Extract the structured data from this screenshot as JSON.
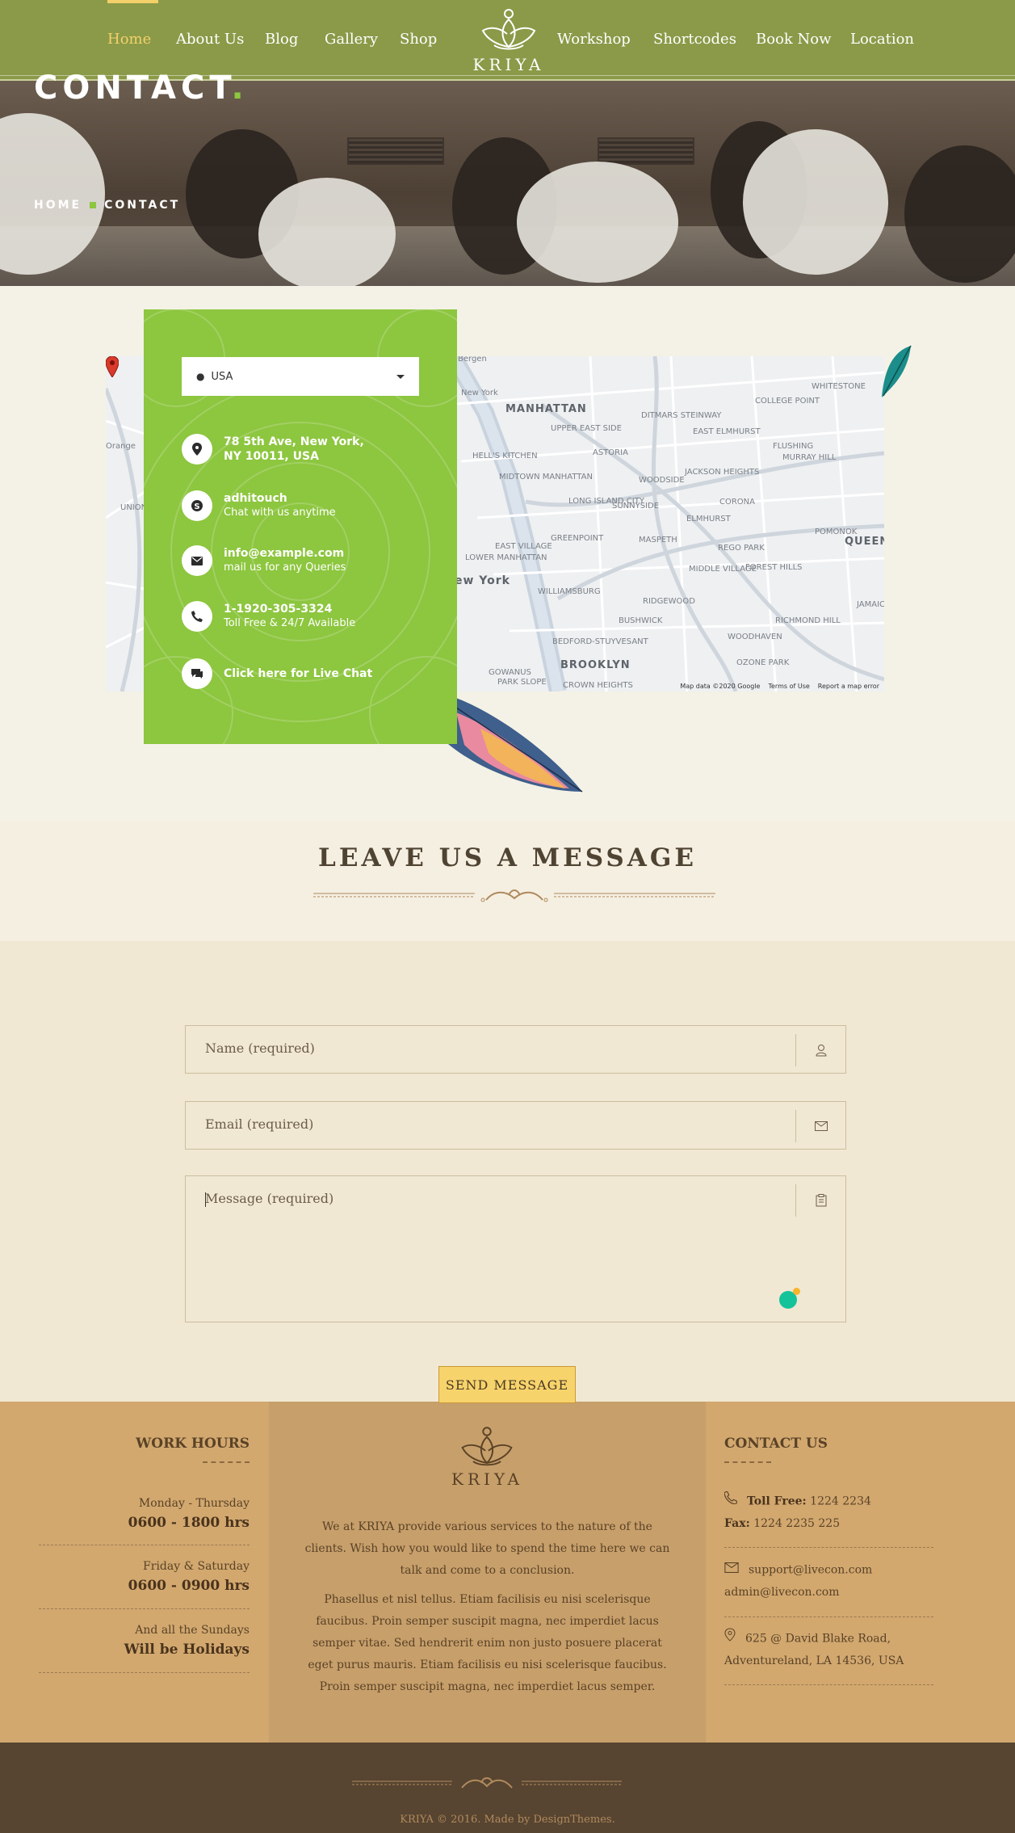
{
  "nav": {
    "items": [
      {
        "label": "Home",
        "active": true
      },
      {
        "label": "About Us"
      },
      {
        "label": "Blog"
      },
      {
        "label": "Gallery"
      },
      {
        "label": "Shop"
      },
      {
        "label": "Workshop"
      },
      {
        "label": "Shortcodes"
      },
      {
        "label": "Book Now"
      },
      {
        "label": "Location"
      }
    ],
    "logo_text": "KRIYA",
    "active_color": "#f3d06a"
  },
  "hero": {
    "title": "CONTACT",
    "title_dot": ".",
    "breadcrumb": [
      "HOME",
      "CONTACT"
    ]
  },
  "contact_card": {
    "country": "USA",
    "rows": [
      {
        "icon": "location-pin-icon",
        "title": "78 5th Ave, New York,",
        "sub": "NY 10011, USA",
        "sub_bold": true
      },
      {
        "icon": "skype-icon",
        "title": "adhitouch",
        "sub": "Chat with us anytime"
      },
      {
        "icon": "mail-icon",
        "title": "info@example.com",
        "sub": "mail us for any Queries"
      },
      {
        "icon": "phone-icon",
        "title": "1-1920-305-3324",
        "sub": "Toll Free & 24/7 Available"
      },
      {
        "icon": "chat-icon",
        "title": "Click here for Live Chat",
        "sub": ""
      }
    ],
    "card_color": "#8dc63f"
  },
  "map": {
    "labels": [
      "MANHATTAN",
      "QUEENS",
      "BROOKLYN",
      "ew York",
      "Bergen",
      "ASTORIA",
      "UPPER EAST SIDE",
      "HELL'S KITCHEN",
      "MIDTOWN MANHATTAN",
      "EAST VILLAGE",
      "LONG ISLAND CITY",
      "SUNNYSIDE",
      "WOODSIDE",
      "JACKSON HEIGHTS",
      "CORONA",
      "ELMHURST",
      "MASPETH",
      "GREENPOINT",
      "WILLIAMSBURG",
      "BUSHWICK",
      "RIDGEWOOD",
      "MIDDLE VILLAGE",
      "FOREST HILLS",
      "REGO PARK",
      "FLUSHING",
      "MURRAY HILL",
      "COLLEGE POINT",
      "WHITESTONE",
      "EAST ELMHURST",
      "DITMARS STEINWAY",
      "BEDFORD-STUYVESANT",
      "WOODHAVEN",
      "RICHMOND HILL",
      "OZONE PARK",
      "GOWANUS",
      "PARK SLOPE",
      "CROWN HEIGHTS",
      "POMONOK",
      "JAMAICA",
      "Orange",
      "UNION HEIGHTS",
      "LOWER MANHATTAN",
      "New York"
    ],
    "footer": [
      "Map data ©2020 Google",
      "Terms of Use",
      "Report a map error"
    ]
  },
  "message": {
    "title": "LEAVE US A MESSAGE",
    "name_placeholder": "Name (required)",
    "email_placeholder": "Email (required)",
    "message_placeholder": "Message (required)",
    "send_label": "SEND MESSAGE"
  },
  "footer": {
    "work_hours": {
      "heading": "WORK HOURS",
      "rows": [
        {
          "day": "Monday - Thursday",
          "time": "0600 - 1800 hrs"
        },
        {
          "day": "Friday & Saturday",
          "time": "0600 - 0900 hrs"
        },
        {
          "day": "And all the Sundays",
          "time": "Will be Holidays"
        }
      ]
    },
    "about": {
      "logo_text": "KRIYA",
      "para1": "We at KRIYA provide various services to the nature of the clients. Wish how you would like to spend the time here we can talk and come to a conclusion.",
      "para2": "Phasellus et nisl tellus. Etiam facilisis eu nisi scelerisque faucibus. Proin semper suscipit magna, nec imperdiet lacus semper vitae. Sed hendrerit enim non justo posuere placerat eget purus mauris. Etiam facilisis eu nisi scelerisque faucibus. Proin semper suscipit magna, nec imperdiet lacus semper."
    },
    "contact": {
      "heading": "CONTACT US",
      "toll_label": "Toll Free:",
      "toll": "1224 2234",
      "fax_label": "Fax:",
      "fax": "1224 2235 225",
      "email1": "support@livecon.com",
      "email2": "admin@livecon.com",
      "address1": "625 @ David Blake Road,",
      "address2": "Adventureland, LA 14536, USA"
    },
    "copyright": "KRIYA © 2016. Made by DesignThemes."
  }
}
